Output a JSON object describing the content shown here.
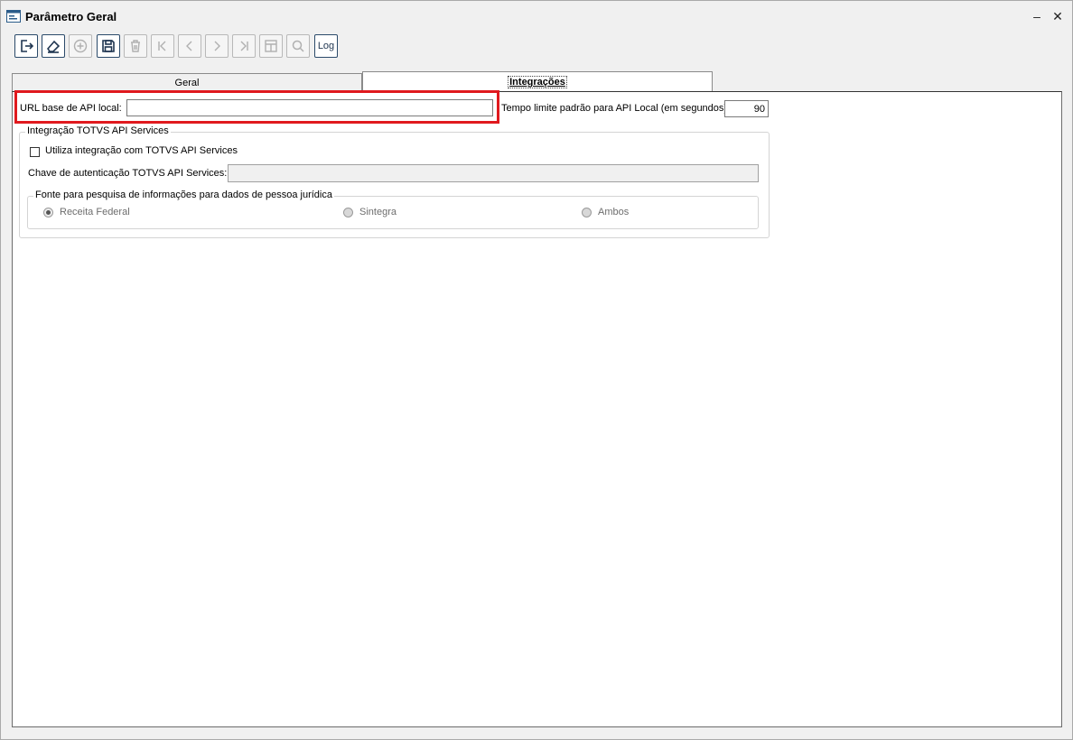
{
  "window": {
    "title": "Parâmetro Geral",
    "minimize_glyph": "–",
    "close_glyph": "✕"
  },
  "toolbar": {
    "buttons": [
      {
        "name": "exit-icon",
        "enabled": true
      },
      {
        "name": "eraser-icon",
        "enabled": true
      },
      {
        "name": "add-circle-icon",
        "enabled": false
      },
      {
        "name": "save-icon",
        "enabled": true
      },
      {
        "name": "trash-icon",
        "enabled": false
      },
      {
        "name": "first-record-icon",
        "enabled": false
      },
      {
        "name": "previous-record-icon",
        "enabled": false
      },
      {
        "name": "next-record-icon",
        "enabled": false
      },
      {
        "name": "last-record-icon",
        "enabled": false
      },
      {
        "name": "grid-icon",
        "enabled": false
      },
      {
        "name": "search-icon",
        "enabled": false
      }
    ],
    "log_label": "Log"
  },
  "tabs": [
    {
      "label": "Geral",
      "active": false
    },
    {
      "label": "Integrações",
      "active": true
    }
  ],
  "form": {
    "url_label": "URL base de API local:",
    "url_value": "",
    "timeout_label": "Tempo limite padrão para API Local (em segundos):",
    "timeout_value": "90",
    "totvs_group": {
      "title": "Integração TOTVS API Services",
      "checkbox_label": "Utiliza integração com TOTVS API Services",
      "checkbox_checked": false,
      "key_label": "Chave de autenticação TOTVS API Services:",
      "key_value": "",
      "fonte_group": {
        "title": "Fonte para pesquisa de informações para dados de pessoa jurídica",
        "options": [
          {
            "label": "Receita Federal",
            "checked": true
          },
          {
            "label": "Sintegra",
            "checked": false
          },
          {
            "label": "Ambos",
            "checked": false
          }
        ]
      }
    }
  },
  "colors": {
    "highlight": "#e0191e",
    "icon_active": "#1f3550",
    "icon_disabled": "#b0b0b0"
  }
}
